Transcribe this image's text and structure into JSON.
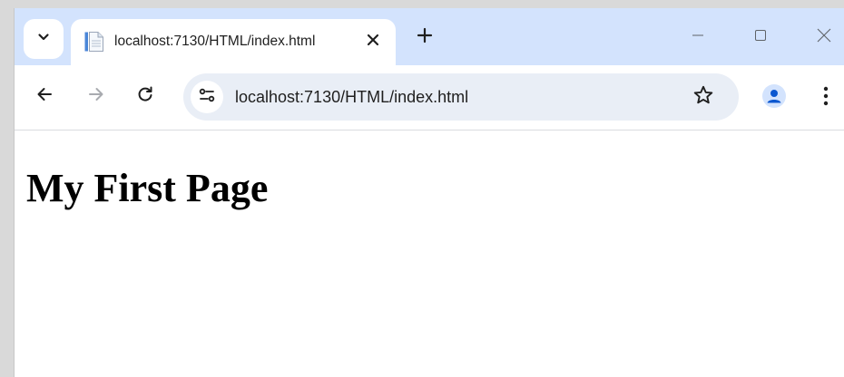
{
  "tab": {
    "title": "localhost:7130/HTML/index.html",
    "favicon": "page-icon"
  },
  "omnibox": {
    "url": "localhost:7130/HTML/index.html"
  },
  "page": {
    "heading": "My First Page"
  },
  "icons": {
    "tab_search": "chevron-down-icon",
    "tab_close": "close-icon",
    "new_tab": "plus-icon",
    "minimize": "minimize-icon",
    "maximize": "maximize-icon",
    "close_window": "close-icon",
    "back": "arrow-left-icon",
    "forward": "arrow-right-icon",
    "reload": "reload-icon",
    "site_info": "tune-icon",
    "bookmark": "star-outline-icon",
    "profile": "person-icon",
    "menu": "more-vert-icon"
  },
  "colors": {
    "tabstrip_bg": "#d3e3fd",
    "omnibox_bg": "#e9eef6",
    "profile_blue": "#0b57d0",
    "text": "#1f1f1f"
  }
}
